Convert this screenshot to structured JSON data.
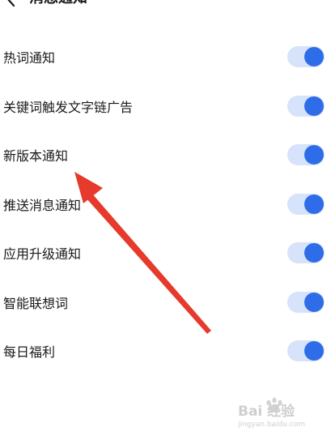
{
  "header": {
    "title": "消息通知"
  },
  "settings": [
    {
      "label": "热词通知",
      "enabled": true
    },
    {
      "label": "关键词触发文字链广告",
      "enabled": true
    },
    {
      "label": "新版本通知",
      "enabled": true
    },
    {
      "label": "推送消息通知",
      "enabled": true
    },
    {
      "label": "应用升级通知",
      "enabled": true
    },
    {
      "label": "智能联想词",
      "enabled": true
    },
    {
      "label": "每日福利",
      "enabled": true
    }
  ],
  "colors": {
    "accent": "#2f6de8",
    "track": "#d6e3fb",
    "annotation": "#e53a2c"
  },
  "watermark": {
    "brand": "Bai 经验",
    "url": "jingyan.baidu.com"
  }
}
